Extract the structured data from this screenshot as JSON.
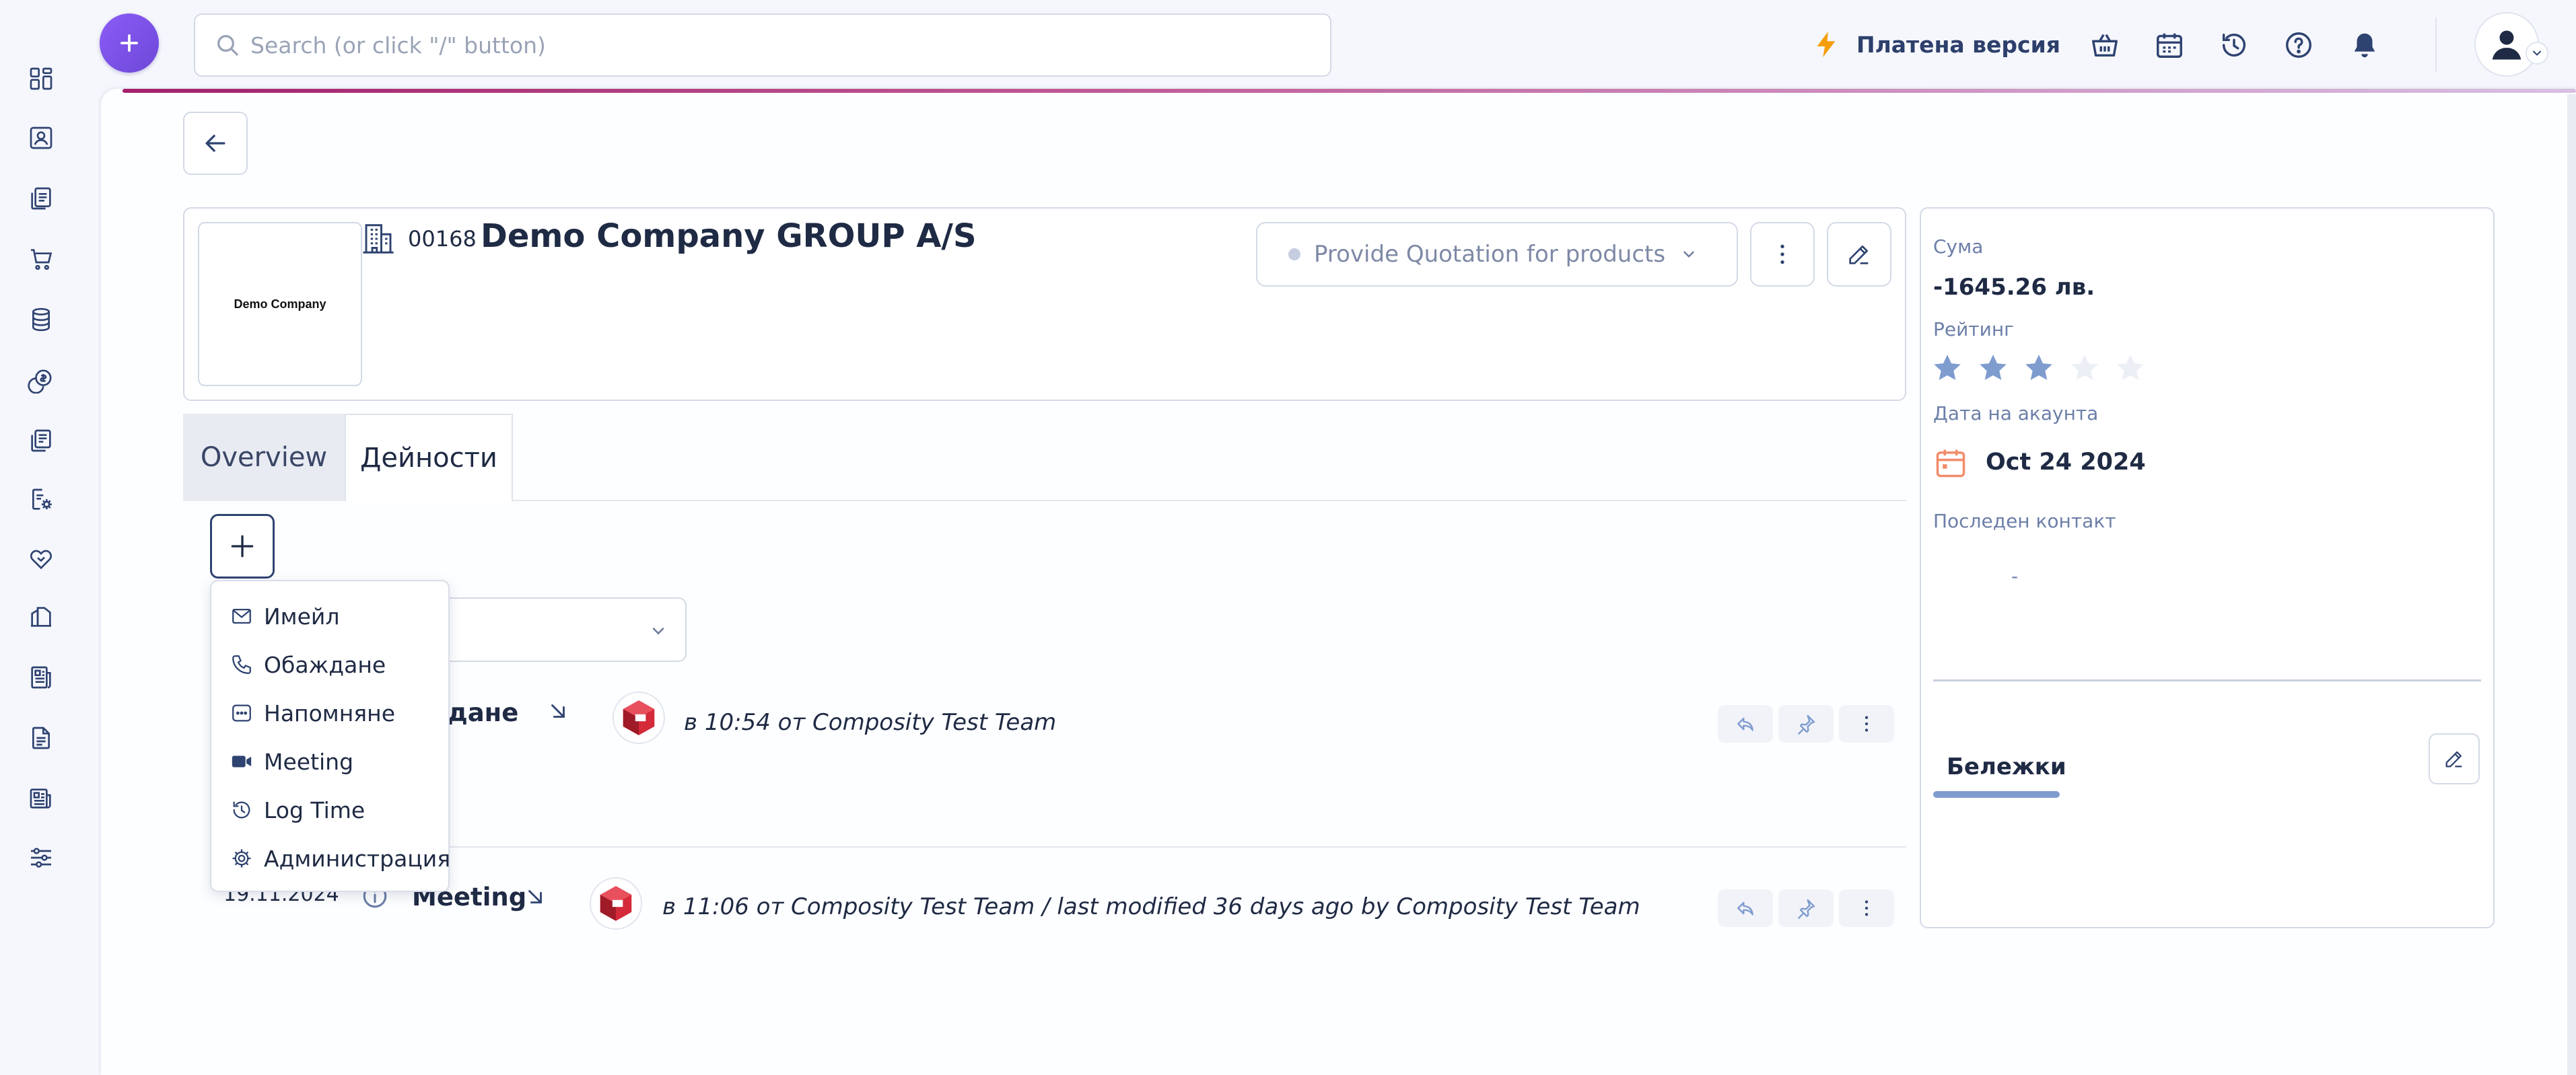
{
  "sidebar": {
    "items": [
      {
        "icon": "dashboard-icon"
      },
      {
        "icon": "contacts-icon"
      },
      {
        "icon": "documents-icon"
      },
      {
        "icon": "cart-icon"
      },
      {
        "icon": "database-icon"
      },
      {
        "icon": "finance-icon"
      },
      {
        "icon": "records-icon"
      },
      {
        "icon": "settings-docs-icon"
      },
      {
        "icon": "handshake-icon"
      },
      {
        "icon": "reports-icon"
      },
      {
        "icon": "news-icon"
      },
      {
        "icon": "file-icon"
      },
      {
        "icon": "newspaper-icon"
      },
      {
        "icon": "sliders-icon"
      }
    ]
  },
  "topbar": {
    "search_placeholder": "Search (or click \"/\" button)",
    "premium_label": "Платена версия",
    "icons": [
      "basket-icon",
      "calendar-icon",
      "history-icon",
      "help-icon",
      "bell-icon"
    ]
  },
  "account": {
    "logo_text": "Demo Company",
    "number": "00168",
    "name": "Demo Company GROUP A/S",
    "status": "Provide Quotation for products"
  },
  "tabs": {
    "overview": "Overview",
    "activities": "Дейности"
  },
  "add_menu": {
    "items": [
      {
        "label": "Имейл",
        "icon": "mail-icon"
      },
      {
        "label": "Обаждане",
        "icon": "phone-icon"
      },
      {
        "label": "Напомняне",
        "icon": "reminder-icon"
      },
      {
        "label": "Meeting",
        "icon": "video-icon"
      },
      {
        "label": "Log Time",
        "icon": "clock-history-icon"
      },
      {
        "label": "Администрация",
        "icon": "gear-icon"
      }
    ]
  },
  "activities": [
    {
      "title": "ждане",
      "meta": "в 10:54 от Composity Test Team"
    },
    {
      "date": "19.11.2024",
      "title": "Meeting",
      "meta": "в 11:06 от Composity Test Team / last modified 36 days ago by Composity Test Team"
    }
  ],
  "side": {
    "amount_label": "Сума",
    "amount_value": "-1645.26 лв.",
    "rating_label": "Рейтинг",
    "rating": 3,
    "rating_max": 5,
    "account_date_label": "Дата на акаунта",
    "account_date": "Oct 24 2024",
    "last_contact_label": "Последен контакт",
    "last_contact": "-",
    "notes_tab": "Бележки"
  },
  "colors": {
    "accent_purple": "#7c55e0",
    "premium_bolt": "#f59e0b",
    "navy": "#2f4371",
    "star_filled": "#7f9ccf",
    "calendar_orange": "#f28c6a"
  }
}
